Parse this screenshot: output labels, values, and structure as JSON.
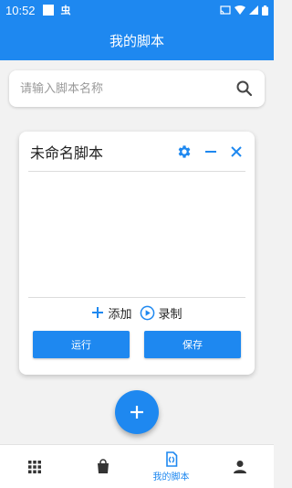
{
  "status_bar": {
    "time": "10:52",
    "bug_glyph": "虫"
  },
  "app_bar": {
    "title": "我的脚本"
  },
  "search": {
    "placeholder": "请输入脚本名称",
    "value": ""
  },
  "script_card": {
    "title": "未命名脚本",
    "tools": {
      "add_label": "添加",
      "record_label": "录制"
    },
    "buttons": {
      "run_label": "运行",
      "save_label": "保存"
    }
  },
  "bottom_nav": {
    "items": [
      {
        "icon": "grid-icon",
        "label": ""
      },
      {
        "icon": "shopping-bag-icon",
        "label": ""
      },
      {
        "icon": "script-file-icon",
        "label": "我的脚本",
        "active": true
      },
      {
        "icon": "person-icon",
        "label": ""
      }
    ]
  },
  "colors": {
    "primary": "#1e88f0",
    "background": "#f2f2f2",
    "card": "#ffffff"
  }
}
